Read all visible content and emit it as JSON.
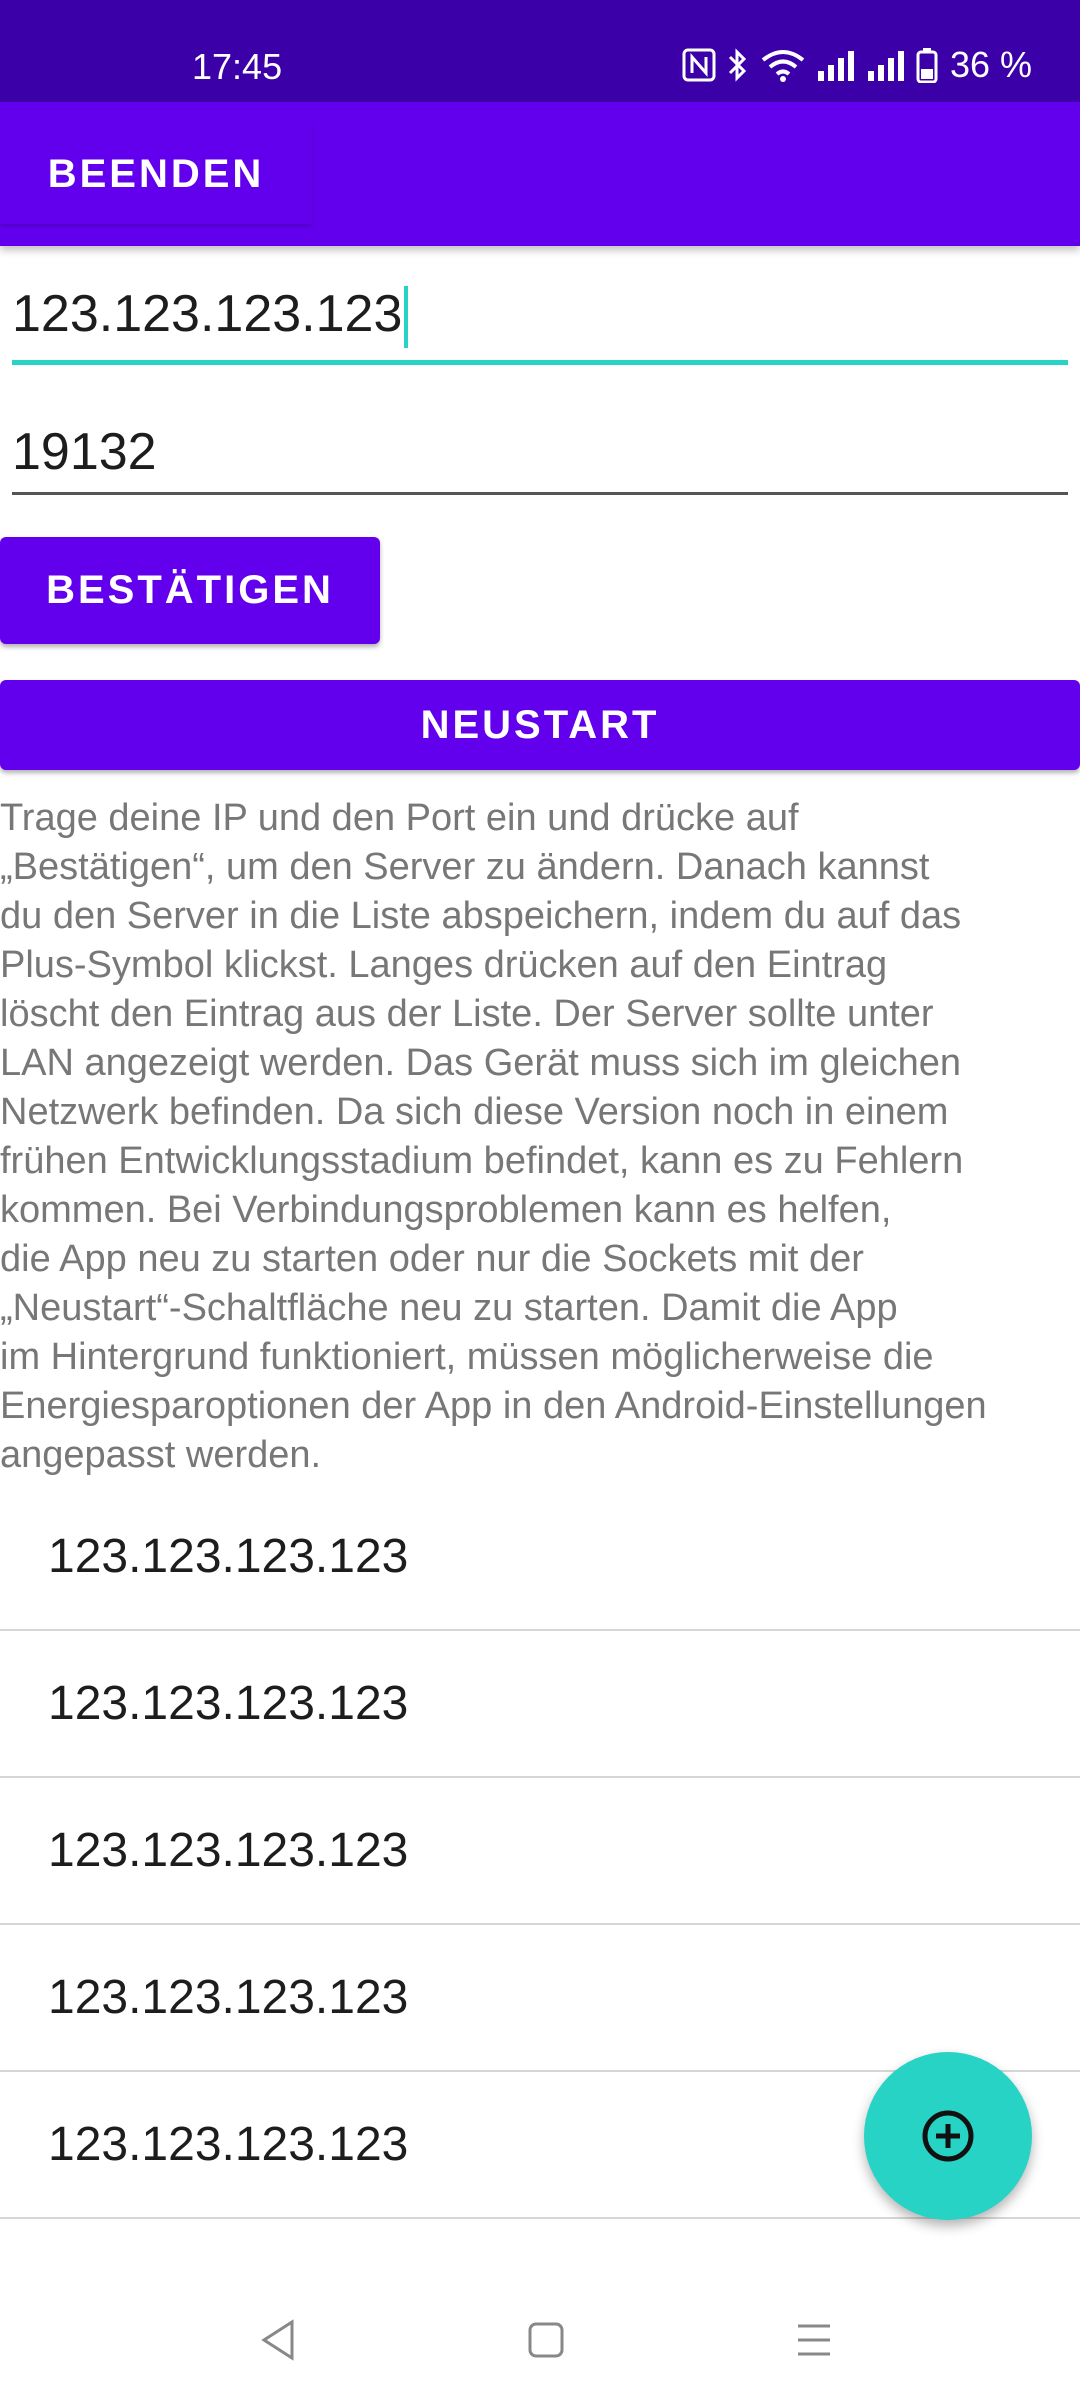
{
  "status_bar": {
    "time": "17:45",
    "battery": "36 %",
    "icons": [
      "nfc-icon",
      "bluetooth-icon",
      "wifi-icon",
      "signal-icon",
      "signal-icon",
      "battery-icon"
    ]
  },
  "app_bar": {
    "exit_label": "BEENDEN"
  },
  "form": {
    "ip_value": "123.123.123.123",
    "port_value": "19132",
    "confirm_label": "BESTÄTIGEN",
    "restart_label": "NEUSTART"
  },
  "info_text": "Trage deine IP und den Port ein und drücke auf\n„Bestätigen“, um den Server zu ändern. Danach kannst\ndu den Server in die Liste abspeichern, indem du auf das\nPlus-Symbol klickst. Langes drücken auf den Eintrag\nlöscht den Eintrag aus der Liste. Der Server sollte unter\nLAN angezeigt werden. Das Gerät muss sich im gleichen\nNetzwerk befinden. Da sich diese Version noch in einem\nfrühen Entwicklungsstadium befindet, kann es zu Fehlern\nkommen. Bei Verbindungsproblemen kann es helfen,\ndie App neu zu starten oder nur die Sockets mit der\n„Neustart“-Schaltfläche neu zu starten. Damit die App\nim Hintergrund funktioniert, müssen möglicherweise die\nEnergiesparoptionen der App in den Android-Einstellungen\nangepasst werden.",
  "server_list": [
    {
      "label": "123.123.123.123"
    },
    {
      "label": "123.123.123.123"
    },
    {
      "label": "123.123.123.123"
    },
    {
      "label": "123.123.123.123"
    },
    {
      "label": "123.123.123.123"
    }
  ],
  "fab": {
    "icon": "add-circle-icon"
  },
  "nav_bar": {
    "icons": [
      "back-icon",
      "home-icon",
      "menu-icon"
    ]
  },
  "colors": {
    "primary": "#6200ee",
    "status_bar": "#3c00a9",
    "accent": "#26d3c4"
  }
}
